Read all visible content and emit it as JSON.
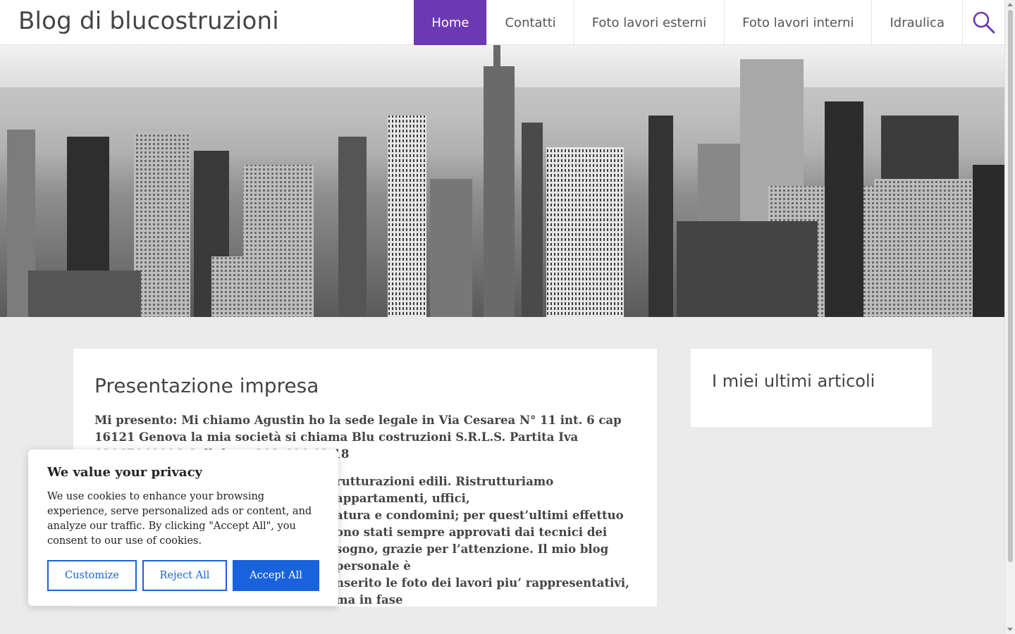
{
  "header": {
    "site_title": "Blog di blucostruzioni",
    "nav": [
      {
        "label": "Home",
        "active": true
      },
      {
        "label": "Contatti"
      },
      {
        "label": "Foto lavori esterni"
      },
      {
        "label": "Foto lavori interni"
      },
      {
        "label": "Idraulica"
      }
    ],
    "search_icon": "search-icon",
    "accent_color": "#6d39b3"
  },
  "hero": {
    "image": "black-and-white-city-skyline"
  },
  "post": {
    "title": "Presentazione impresa",
    "paragraph1": "Mi presento: Mi chiamo Agustin ho la sede legale in Via Cesarea N° 11 int. 6 cap 16121 Genova la mia società si chiama Blu costruzioni S.R.L.S. Partita Iva 02867040996 Cellulare: 393-604.82.18",
    "paragraph2_lines": [
      "rutturazioni edili. Ristrutturiamo appartamenti, uffici,",
      "atura e condomini; per quest’ultimi effettuo",
      "ono stati sempre approvati dai tecnici dei",
      "sogno, grazie per l’attenzione. Il mio blog personale è",
      "nserito le foto dei lavori piu’ rappresentativi, ma in fase"
    ]
  },
  "sidebar": {
    "title": "I miei ultimi articoli"
  },
  "cookie_banner": {
    "title": "We value your privacy",
    "text": "We use cookies to enhance your browsing experience, serve personalized ads or content, and analyze our traffic. By clicking \"Accept All\", you consent to our use of cookies.",
    "customize_label": "Customize",
    "reject_label": "Reject All",
    "accept_label": "Accept All",
    "button_color": "#1863dc"
  }
}
